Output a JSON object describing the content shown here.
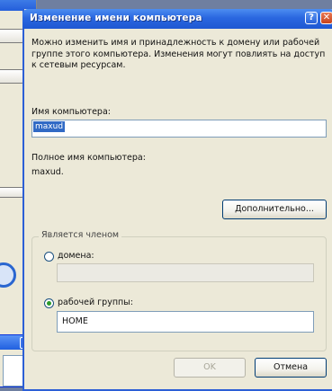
{
  "dialog": {
    "title": "Изменение имени компьютера",
    "help_glyph": "?",
    "close_glyph": "✕",
    "description": "Можно изменить имя и принадлежность к домену или рабочей группе этого компьютера. Изменения могут повлиять на доступ к сетевым ресурсам.",
    "computer_name_label": "Имя компьютера:",
    "computer_name_value": "maxud",
    "full_name_label": "Полное имя компьютера:",
    "full_name_value": "maxud.",
    "more_button": "Дополнительно...",
    "member_of": {
      "title": "Является членом",
      "domain_label": "домена:",
      "domain_value": "",
      "workgroup_label": "рабочей группы:",
      "workgroup_value": "HOME",
      "selected": "workgroup"
    },
    "ok_button": "OK",
    "cancel_button": "Отмена"
  },
  "background": {
    "window_help_glyph": "?",
    "window_close_glyph": "✕"
  }
}
